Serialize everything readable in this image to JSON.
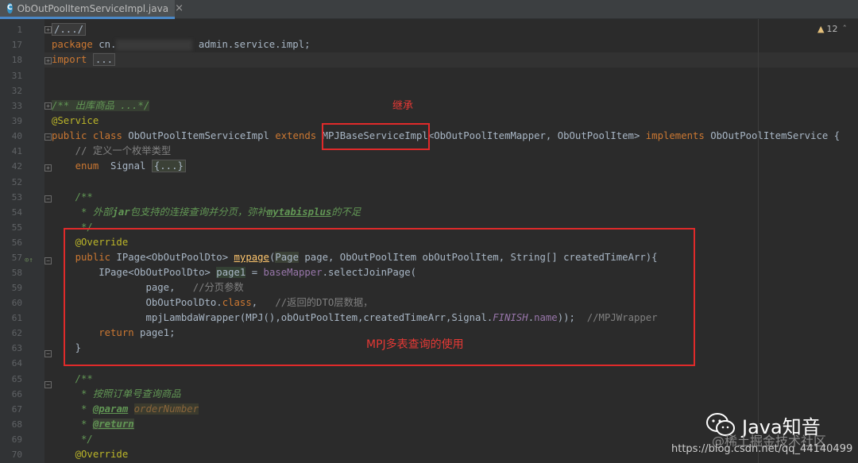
{
  "tab": {
    "label": "ObOutPoolItemServiceImpl.java",
    "icon": "C",
    "close": "×"
  },
  "inspections": {
    "warnings": "12"
  },
  "gutter": {
    "line_numbers": [
      "1",
      "17",
      "18",
      "31",
      "32",
      "33",
      "39",
      "40",
      "41",
      "42",
      "52",
      "53",
      "54",
      "55",
      "56",
      "57",
      "58",
      "59",
      "60",
      "61",
      "62",
      "63",
      "64",
      "65",
      "66",
      "67",
      "68",
      "69",
      "70"
    ]
  },
  "code": {
    "l1": "/.../",
    "l17_kw": "package",
    "l17_a": " cn.",
    "l17_b": " admin.service.impl;",
    "l18_kw": "import",
    "l18_fold": "...",
    "l33": "/** 出库商品 ...*/",
    "l39": "@Service",
    "l40_public": "public",
    "l40_class": " class",
    "l40_name": " ObOutPoolItemServiceImpl ",
    "l40_extends": "extends",
    "l40_base": " MPJBaseServiceImpl",
    "l40_generic": "<ObOutPoolItemMapper, ObOutPoolItem> ",
    "l40_implements": "implements",
    "l40_iface": " ObOutPoolItemService {",
    "l41": "    // 定义一个枚举类型",
    "l42_enum": "    enum",
    "l42_name": "  Signal ",
    "l42_fold": "{...}",
    "l53": "    /**",
    "l54_a": "     * 外部",
    "l54_b": "jar",
    "l54_c": "包支持的连接查询并分页，弥补",
    "l54_d": "mytabisplus",
    "l54_e": "的不足",
    "l55": "     */",
    "l56": "    @Override",
    "l57_public": "    public",
    "l57_ret": " IPage<ObOutPoolDto> ",
    "l57_fn": "mypage",
    "l57_paren": "(",
    "l57_page_t": "Page",
    "l57_rest": " page, ObOutPoolItem obOutPoolItem, String[] createdTimeArr){",
    "l58_a": "        IPage<ObOutPoolDto> ",
    "l58_var": "page1",
    "l58_b": " = ",
    "l58_field": "baseMapper",
    "l58_c": ".selectJoinPage(",
    "l59_a": "                page,   ",
    "l59_cmt": "//分页参数",
    "l60_a": "                ObOutPoolDto.",
    "l60_kw": "class",
    "l60_b": ",   ",
    "l60_cmt": "//返回的DTO层数据，",
    "l61_a": "                mpjLambdaWrapper(MPJ(),obOutPoolItem,createdTimeArr,Signal.",
    "l61_const": "FINISH",
    "l61_b": ".",
    "l61_field": "name",
    "l61_c": "));  ",
    "l61_cmt": "//MPJWrapper",
    "l62_kw": "        return",
    "l62_b": " page1;",
    "l63": "    }",
    "l65": "    /**",
    "l66": "     * 按照订单号查询商品",
    "l67_a": "     * ",
    "l67_tag": "@param",
    "l67_b": " ",
    "l67_param": "orderNumber",
    "l68_a": "     * ",
    "l68_tag": "@return",
    "l69": "     */",
    "l70": "    @Override"
  },
  "annotations": {
    "inherit": "继承",
    "mpj_usage": "MPJ多表查询的使用"
  },
  "watermark": {
    "title": "Java知音",
    "juejin": "@稀土掘金技术社区",
    "url": "https://blog.csdn.net/qq_44140499"
  },
  "colors": {
    "annotation_red": "#e02a2a",
    "background": "#2b2b2b",
    "keyword": "#cc7832"
  }
}
